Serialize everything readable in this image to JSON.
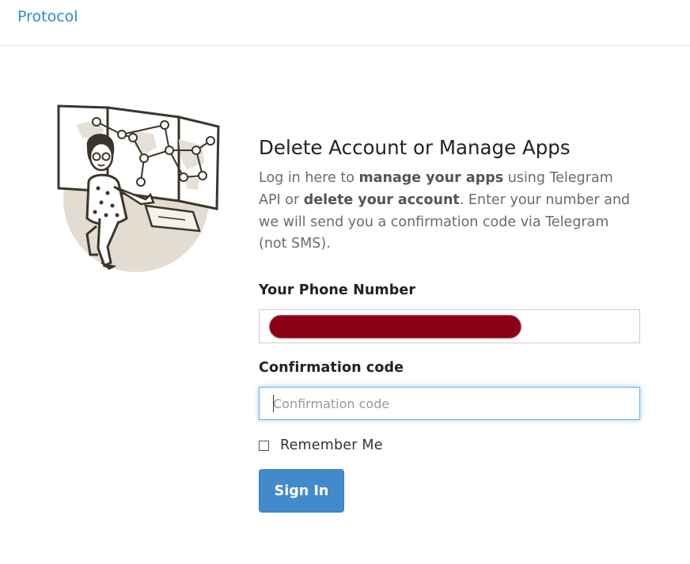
{
  "header": {
    "brand_link": "Protocol"
  },
  "main": {
    "title": "Delete Account or Manage Apps",
    "intro": {
      "part1": "Log in here to ",
      "bold1": "manage your apps",
      "part2": " using Telegram API or ",
      "bold2": "delete your account",
      "part3": ". Enter your number and we will send you a confirmation code via Telegram (not SMS)."
    },
    "phone_label": "Your Phone Number",
    "code_label": "Confirmation code",
    "code_placeholder": "Confirmation code",
    "remember_label": "Remember Me",
    "submit_label": "Sign In"
  },
  "colors": {
    "link": "#2a8dc6",
    "button": "#428bca",
    "redaction": "#8b0016",
    "focus": "#66afe9"
  }
}
